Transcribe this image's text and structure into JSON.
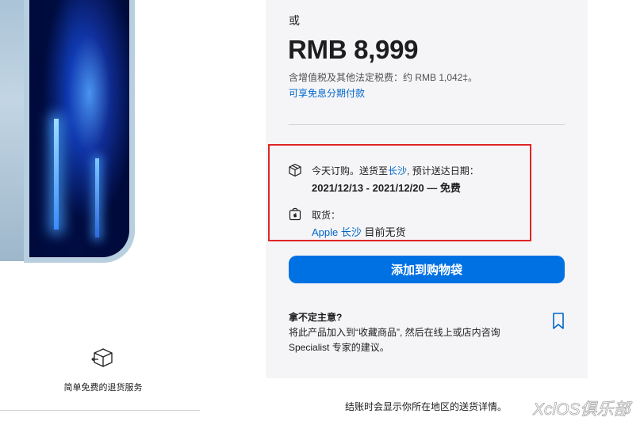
{
  "purchase": {
    "or_text": "或",
    "price": "RMB 8,999",
    "tax_note": "含增值税及其他法定税费：约 RMB 1,042‡。",
    "installment_link": "可享免息分期付款"
  },
  "delivery": {
    "prefix": "今天订购。送货至",
    "city_link": "长沙",
    "suffix": ", 预计送达日期：",
    "dates": "2021/12/13 - 2021/12/20 — 免费"
  },
  "pickup": {
    "label": "取货：",
    "store_link": "Apple 长沙",
    "status": "目前无货"
  },
  "add_to_bag_label": "添加到购物袋",
  "undecided": {
    "title": "拿不定主意?",
    "body": "将此产品加入到“收藏商品”, 然后在线上或店内咨询 Specialist 专家的建议。"
  },
  "return_service": "简单免费的退货服务",
  "checkout_note": "结账时会显示你所在地区的送货详情。",
  "watermark": "XclOS俱乐部",
  "colors": {
    "accent": "#0071e3",
    "link": "#0066cc",
    "highlight_border": "#e02525",
    "panel_bg": "#f5f5f7"
  },
  "icons": [
    "box-icon",
    "apple-bag-icon",
    "bookmark-icon",
    "return-box-icon"
  ]
}
